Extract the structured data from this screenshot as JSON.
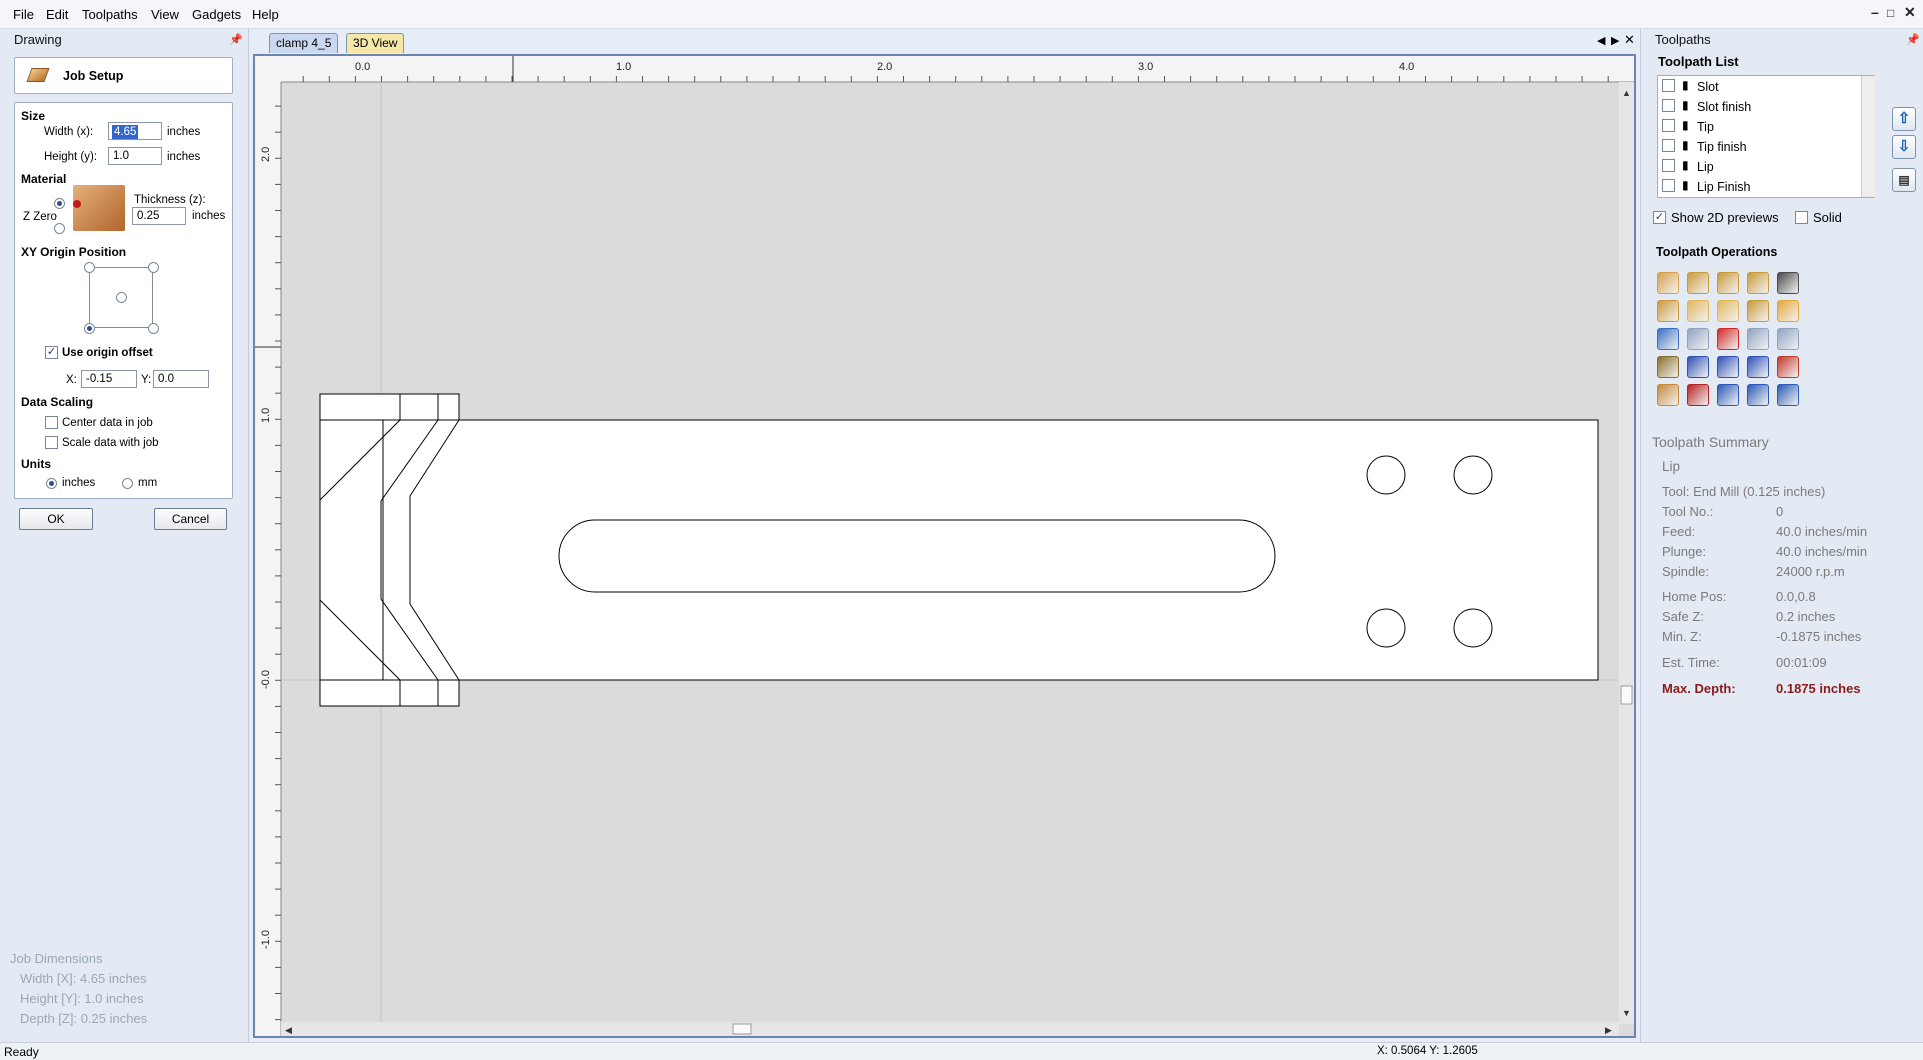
{
  "menu": [
    "File",
    "Edit",
    "Toolpaths",
    "View",
    "Gadgets",
    "Help"
  ],
  "window_controls": [
    "–",
    "□",
    "✕"
  ],
  "left_panel": {
    "title": "Drawing",
    "header": "Job Setup",
    "size": {
      "section": "Size",
      "width_label": "Width (x):",
      "width_value": "4.65",
      "height_label": "Height (y):",
      "height_value": "1.0",
      "unit": "inches"
    },
    "material": {
      "section": "Material",
      "thickness_label": "Thickness (z):",
      "thickness_value": "0.25",
      "unit": "inches",
      "zzero_label": "Z Zero"
    },
    "origin": {
      "section": "XY Origin Position",
      "use_offset_label": "Use origin offset",
      "use_offset_checked": true,
      "x_label": "X:",
      "x_value": "-0.15",
      "y_label": "Y:",
      "y_value": "0.0"
    },
    "scaling": {
      "section": "Data Scaling",
      "center_label": "Center data in job",
      "scale_label": "Scale data with job"
    },
    "units": {
      "section": "Units",
      "inches": "inches",
      "mm": "mm",
      "selected": "inches"
    },
    "ok": "OK",
    "cancel": "Cancel",
    "job_dimensions": {
      "title": "Job Dimensions",
      "width": "Width  [X]: 4.65 inches",
      "height": "Height [Y]: 1.0 inches",
      "depth": "Depth  [Z]: 0.25 inches"
    }
  },
  "tabs": [
    "clamp 4_5",
    "3D View"
  ],
  "ruler": {
    "x_labels": [
      "0.0",
      "1.0",
      "2.0",
      "3.0",
      "4.0"
    ],
    "y_labels": [
      "2.0",
      "1.0",
      "-0.0",
      "-1.0"
    ]
  },
  "status": {
    "left": "Ready",
    "coords": "X: 0.5064 Y: 1.2605"
  },
  "right_panel": {
    "title": "Toolpaths",
    "list_title": "Toolpath List",
    "items": [
      "Slot",
      "Slot finish",
      "Tip",
      "Tip finish",
      "Lip",
      "Lip Finish"
    ],
    "show_previews": "Show 2D previews",
    "show_previews_checked": true,
    "solid": "Solid",
    "operations_title": "Toolpath Operations",
    "summary_title": "Toolpath Summary",
    "summary_name": "Lip",
    "tool": "Tool: End Mill (0.125 inches)",
    "rows": [
      {
        "k": "Tool No.:",
        "v": "0"
      },
      {
        "k": "Feed:",
        "v": "40.0 inches/min"
      },
      {
        "k": "Plunge:",
        "v": "40.0 inches/min"
      },
      {
        "k": "Spindle:",
        "v": "24000 r.p.m"
      },
      {
        "k": "Home Pos:",
        "v": "0.0,0.8"
      },
      {
        "k": "Safe Z:",
        "v": "0.2 inches"
      },
      {
        "k": "Min. Z:",
        "v": "-0.1875 inches"
      },
      {
        "k": "Est. Time:",
        "v": "00:01:09"
      }
    ],
    "max_depth_label": "Max. Depth:",
    "max_depth_value": "0.1875 inches",
    "accent_red": "#8b1a1a"
  }
}
